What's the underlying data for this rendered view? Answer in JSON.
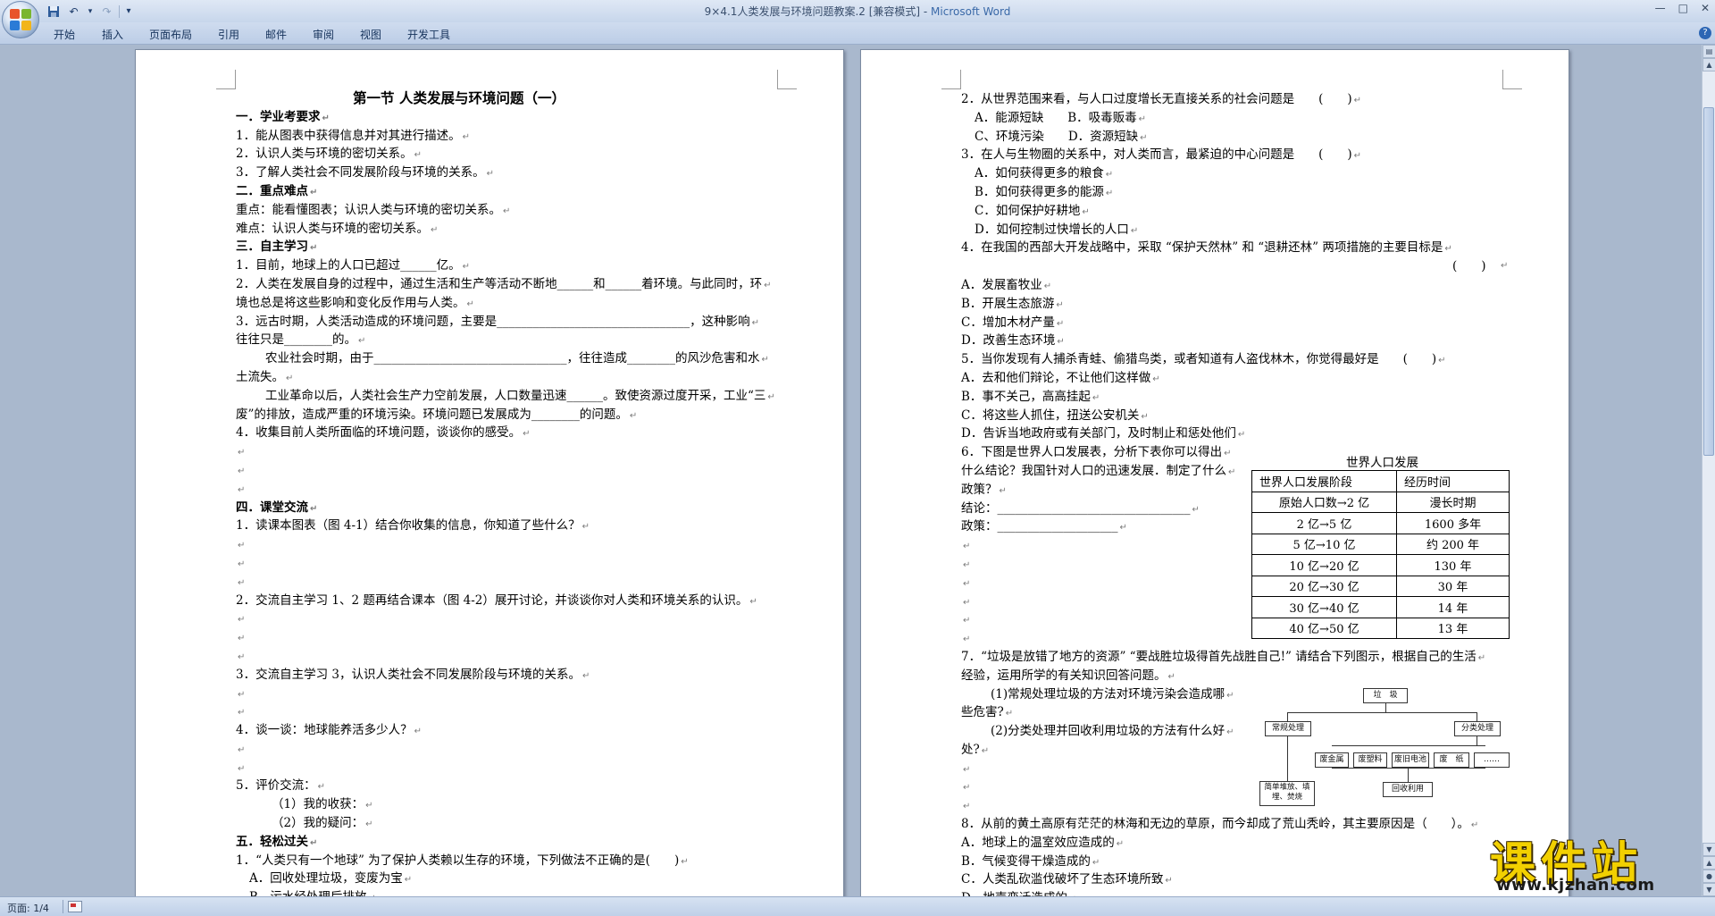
{
  "window": {
    "title_doc": "9×4.1人类发展与环境问题教案.2 [兼容模式] - ",
    "title_app": "Microsoft Word",
    "controls": [
      "—",
      "□",
      "✕"
    ]
  },
  "qat": {
    "save": "save-icon",
    "undo": "undo-icon",
    "redo": "redo-icon",
    "customize": "▾"
  },
  "ribbon": {
    "tabs": [
      "开始",
      "插入",
      "页面布局",
      "引用",
      "邮件",
      "审阅",
      "视图",
      "开发工具"
    ],
    "help": "?"
  },
  "page1": {
    "lines": [
      {
        "t": "第一节 人类发展与环境问题（一）",
        "k": "title"
      },
      {
        "t": "一．学业考要求",
        "k": "h"
      },
      {
        "t": "1．能从图表中获得信息并对其进行描述。"
      },
      {
        "t": "2．认识人类与环境的密切关系。"
      },
      {
        "t": "3．了解人类社会不同发展阶段与环境的关系。"
      },
      {
        "t": "二．重点难点",
        "k": "h"
      },
      {
        "t": "重点：能看懂图表；认识人类与环境的密切关系。"
      },
      {
        "t": "难点：认识人类与环境的密切关系。"
      },
      {
        "t": "三．自主学习",
        "k": "h"
      },
      {
        "t": "1．目前，地球上的人口已超过______亿。"
      },
      {
        "t": "2．人类在发展自身的过程中，通过生活和生产等活动不断地______和______着环境。与此同时，环"
      },
      {
        "t": "境也总是将这些影响和变化反作用与人类。"
      },
      {
        "t": "3．远古时期，人类活动造成的环境问题，主要是________________________________，这种影响"
      },
      {
        "t": "往往只是________的。"
      },
      {
        "t": "农业社会时期，由于________________________________，往往造成________的风沙危害和水",
        "k": "i1"
      },
      {
        "t": "土流失。"
      },
      {
        "t": "工业革命以后，人类社会生产力空前发展，人口数量迅速______。致使资源过度开采，工业“三",
        "k": "i1"
      },
      {
        "t": "废”的排放，造成严重的环境污染。环境问题已发展成为________的问题。"
      },
      {
        "t": "4．收集目前人类所面临的环境问题，谈谈你的感受。"
      },
      {
        "t": ""
      },
      {
        "t": ""
      },
      {
        "t": ""
      },
      {
        "t": "四．课堂交流",
        "k": "h"
      },
      {
        "t": "1．读课本图表（图 4-1）结合你收集的信息，你知道了些什么？"
      },
      {
        "t": ""
      },
      {
        "t": ""
      },
      {
        "t": ""
      },
      {
        "t": "2．交流自主学习 1、2 题再结合课本（图 4-2）展开讨论，并谈谈你对人类和环境关系的认识。"
      },
      {
        "t": ""
      },
      {
        "t": ""
      },
      {
        "t": ""
      },
      {
        "t": "3．交流自主学习 3，认识人类社会不同发展阶段与环境的关系。"
      },
      {
        "t": ""
      },
      {
        "t": ""
      },
      {
        "t": "4．谈一谈：地球能养活多少人？"
      },
      {
        "t": ""
      },
      {
        "t": ""
      },
      {
        "t": "5．评价交流："
      },
      {
        "t": "（1）我的收获：",
        "k": "i3"
      },
      {
        "t": "（2）我的疑问：",
        "k": "i3"
      },
      {
        "t": "五．轻松过关",
        "k": "h"
      },
      {
        "t": "1．“人类只有一个地球” 为了保护人类赖以生存的环境，下列做法不正确的是(　　)"
      },
      {
        "t": "A．回收处理垃圾，变废为宝",
        "k": "i2"
      },
      {
        "t": "B．污水经处理后排放",
        "k": "i2"
      }
    ]
  },
  "page2": {
    "lines": [
      {
        "t": "2．从世界范围来看，与人口过度增长无直接关系的社会问题是　　(　　)"
      },
      {
        "t": "A．能源短缺　　B．吸毒贩毒",
        "k": "i2"
      },
      {
        "t": "C、环境污染　　D．资源短缺",
        "k": "i2"
      },
      {
        "t": "3．在人与生物圈的关系中，对人类而言，最紧迫的中心问题是　　(　　)"
      },
      {
        "t": "A．如何获得更多的粮食",
        "k": "i2"
      },
      {
        "t": "B．如何获得更多的能源",
        "k": "i2"
      },
      {
        "t": "C．如何保护好耕地",
        "k": "i2"
      },
      {
        "t": "D．如何控制过快增长的人口",
        "k": "i2"
      },
      {
        "t": "4．在我国的西部大开发战略中，采取 “保护天然林” 和 “退耕还林” 两项措施的主要目标是"
      },
      {
        "t": "(　　)",
        "k": "pr"
      },
      {
        "t": "A．发展畜牧业"
      },
      {
        "t": "B．开展生态旅游"
      },
      {
        "t": "C．增加木材产量"
      },
      {
        "t": "D．改善生态环境"
      },
      {
        "t": "5．当你发现有人捕杀青蛙、偷猎鸟类，或者知道有人盗伐林木，你觉得最好是　　(　　)"
      },
      {
        "t": "A．去和他们辩论，不让他们这样做"
      },
      {
        "t": "B．事不关己，高高挂起"
      },
      {
        "t": "C．将这些人抓住，扭送公安机关"
      },
      {
        "t": "D．告诉当地政府或有关部门，及时制止和惩处他们"
      },
      {
        "t": "6．下图是世界人口发展表，分析下表你可以得出"
      },
      {
        "t": "什么结论？我国针对人口的迅速发展．制定了什么"
      },
      {
        "t": "政策？"
      },
      {
        "t": "结论：________________________________"
      },
      {
        "t": "政策：____________________"
      },
      {
        "t": ""
      },
      {
        "t": ""
      },
      {
        "t": ""
      },
      {
        "t": ""
      },
      {
        "t": ""
      },
      {
        "t": ""
      },
      {
        "t": "7．“垃圾是放错了地方的资源” “要战胜垃圾得首先战胜自己!” 请结合下列图示，根据自己的生活"
      },
      {
        "t": "经验，运用所学的有关知识回答问题。"
      },
      {
        "t": "(1)常规处理垃圾的方法对环境污染会造成哪",
        "k": "i1"
      },
      {
        "t": "些危害?"
      },
      {
        "t": "(2)分类处理并回收利用垃圾的方法有什么好",
        "k": "i1"
      },
      {
        "t": "处?"
      },
      {
        "t": ""
      },
      {
        "t": ""
      },
      {
        "t": ""
      },
      {
        "t": "8．从前的黄土高原有茫茫的林海和无边的草原，而今却成了荒山秃岭，其主要原因是（　　）。"
      },
      {
        "t": "A．地球上的温室效应造成的"
      },
      {
        "t": "B．气候变得干燥造成的"
      },
      {
        "t": "C．人类乱砍滥伐破坏了生态环境所致"
      },
      {
        "t": "D．地壳变迁造成的"
      }
    ],
    "table_title": "世界人口发展",
    "table": [
      [
        "世界人口发展阶段",
        "经历时间"
      ],
      [
        "原始人口数→2 亿",
        "漫长时期"
      ],
      [
        "2 亿→5 亿",
        "1600 多年"
      ],
      [
        "5 亿→10 亿",
        "约 200 年"
      ],
      [
        "10 亿→20 亿",
        "130 年"
      ],
      [
        "20 亿→30 亿",
        "30 年"
      ],
      [
        "30 亿→40 亿",
        "14 年"
      ],
      [
        "40 亿→50 亿",
        "13 年"
      ]
    ],
    "diagram": {
      "root": "垃　圾",
      "left": "常规处理",
      "right": "分类处理",
      "left_child": "简单堆放、填埋、焚烧",
      "cats": [
        "废金属",
        "废塑料",
        "废旧电池",
        "废　纸",
        "……"
      ],
      "recycle": "回收利用"
    }
  },
  "status": {
    "page": "页面: 1/4"
  },
  "watermark": {
    "big": "课件站",
    "small": "www.kjzhan.com"
  }
}
